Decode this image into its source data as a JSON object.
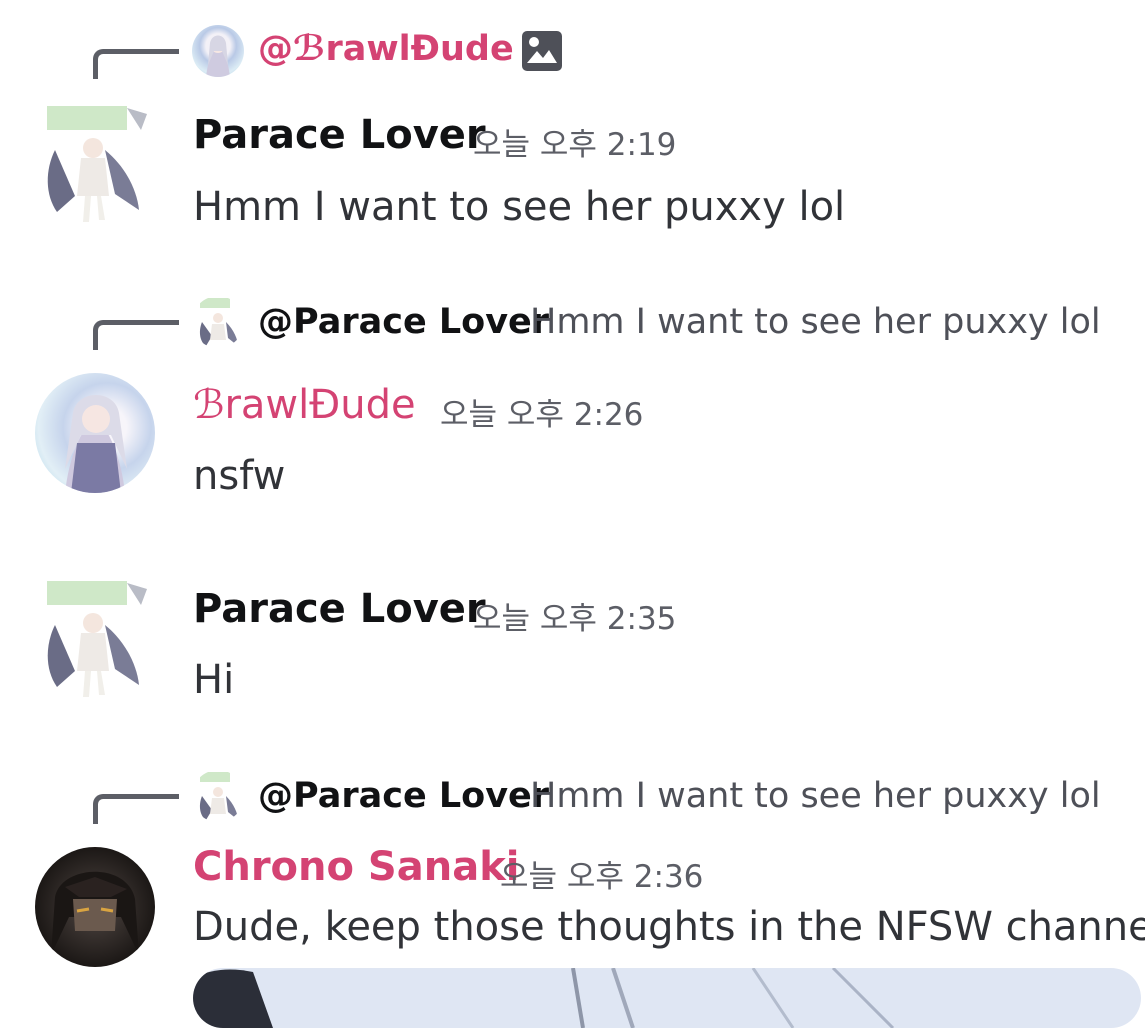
{
  "colors": {
    "accent_pink": "#d44373",
    "name_dark": "#111214",
    "timestamp": "#5c5e66",
    "body_text": "#313338",
    "reply_preview": "#4e5058",
    "background": "#ffffff"
  },
  "messages": [
    {
      "reply": {
        "name": "@ℬrawlĐude",
        "text": "",
        "icon": "image-icon"
      },
      "author": "Parace Lover",
      "time": "오늘 오후 2:19",
      "content": "Hmm I want to see her puxxy lol"
    },
    {
      "reply": {
        "name": "@Parace Lover",
        "text": "Hmm I want to see her puxxy lol"
      },
      "author": "ℬrawlĐude",
      "time": "오늘 오후 2:26",
      "content": "nsfw"
    },
    {
      "author": "Parace Lover",
      "time": "오늘 오후 2:35",
      "content": "Hi"
    },
    {
      "reply": {
        "name": "@Parace Lover",
        "text": "Hmm I want to see her puxxy lol"
      },
      "author": "Chrono Sanaki",
      "time": "오늘 오후 2:36",
      "content": "Dude, keep those thoughts in the NFSW channels"
    }
  ]
}
